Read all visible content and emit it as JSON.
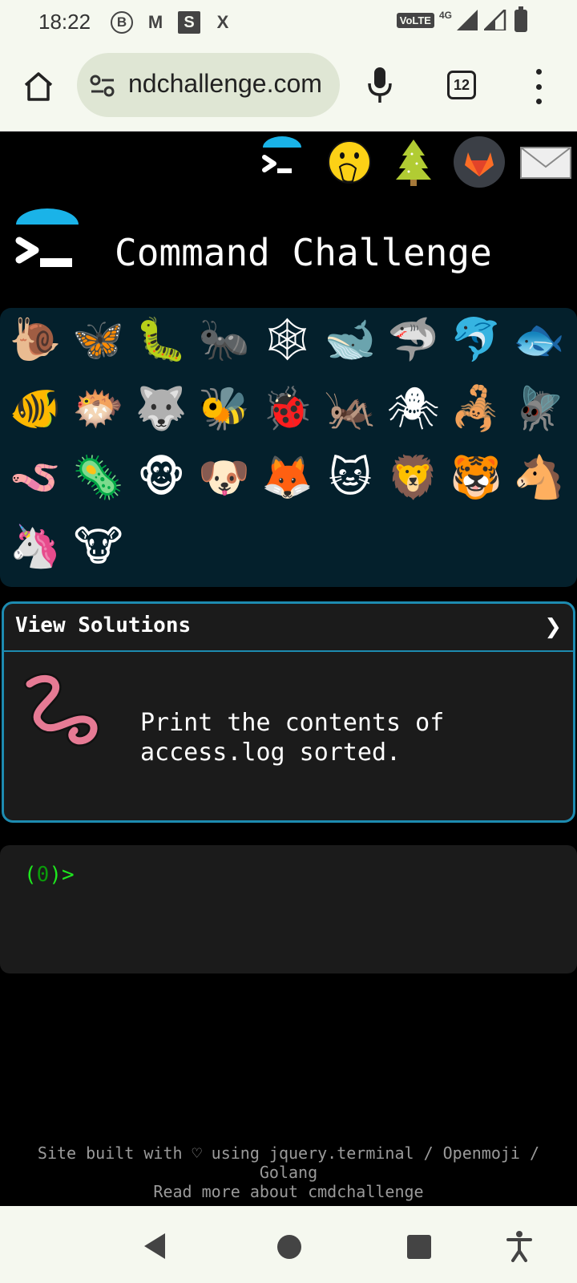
{
  "status_bar": {
    "time": "18:22",
    "notifications": [
      "B",
      "M",
      "S",
      "X"
    ],
    "network_label": "VoLTE",
    "network_type": "4G"
  },
  "browser": {
    "url": "ndchallenge.com",
    "tab_count": "12"
  },
  "top_icons": [
    "terminal-logo-icon",
    "face-hand-over-mouth-icon",
    "pine-tree-icon",
    "gitlab-icon",
    "envelope-icon"
  ],
  "header": {
    "title": "Command Challenge"
  },
  "animals": [
    {
      "name": "snail-icon",
      "glyph": "🐌"
    },
    {
      "name": "butterfly-icon",
      "glyph": "🦋"
    },
    {
      "name": "caterpillar-icon",
      "glyph": "🐛"
    },
    {
      "name": "ant-icon",
      "glyph": "🐜"
    },
    {
      "name": "spider-web-icon",
      "glyph": "🕸"
    },
    {
      "name": "whale-icon",
      "glyph": "🐋"
    },
    {
      "name": "shark-icon",
      "glyph": "🦈"
    },
    {
      "name": "dolphin-icon",
      "glyph": "🐬"
    },
    {
      "name": "fish-icon",
      "glyph": "🐟"
    },
    {
      "name": "tropical-fish-icon",
      "glyph": "🐠"
    },
    {
      "name": "blowfish-icon",
      "glyph": "🐡"
    },
    {
      "name": "wolf-icon",
      "glyph": "🐺"
    },
    {
      "name": "bee-icon",
      "glyph": "🐝"
    },
    {
      "name": "ladybug-icon",
      "glyph": "🐞"
    },
    {
      "name": "cricket-icon",
      "glyph": "🦗"
    },
    {
      "name": "spider-icon",
      "glyph": "🕷"
    },
    {
      "name": "scorpion-icon",
      "glyph": "🦂"
    },
    {
      "name": "fly-icon",
      "glyph": "🪰"
    },
    {
      "name": "worm-icon",
      "glyph": "🪱"
    },
    {
      "name": "microbe-icon",
      "glyph": "🦠"
    },
    {
      "name": "monkey-icon",
      "glyph": "🐵"
    },
    {
      "name": "dog-icon",
      "glyph": "🐶"
    },
    {
      "name": "fox-icon",
      "glyph": "🦊"
    },
    {
      "name": "cat-icon",
      "glyph": "🐱"
    },
    {
      "name": "lion-icon",
      "glyph": "🦁"
    },
    {
      "name": "tiger-icon",
      "glyph": "🐯"
    },
    {
      "name": "horse-icon",
      "glyph": "🐴"
    },
    {
      "name": "unicorn-icon",
      "glyph": "🦄"
    },
    {
      "name": "cow-icon",
      "glyph": "🐮"
    }
  ],
  "solutions": {
    "title": "View Solutions",
    "chevron": "❯",
    "challenge_text": "Print the contents of access.log sorted.",
    "challenge_icon": "worm-icon"
  },
  "terminal": {
    "prompt_open": "(",
    "prompt_count": "0",
    "prompt_close": ")>"
  },
  "footer": {
    "line1": "Site built with ♡ using jquery.terminal / Openmoji /",
    "line2": "Golang",
    "line3": "Read more about cmdchallenge"
  }
}
